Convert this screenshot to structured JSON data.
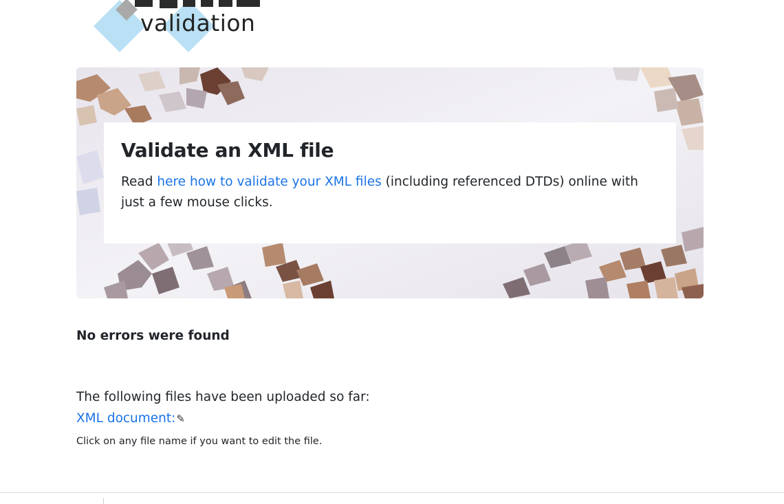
{
  "logo": {
    "text": "validation",
    "colors": {
      "diamond": "#b9e0f4",
      "dark": "#2b2b2b",
      "gray": "#a9a9a9"
    }
  },
  "hero": {
    "title": "Validate an XML file",
    "text_before": "Read ",
    "link_text": "here how to validate your XML files",
    "text_after": " (including referenced DTDs) online with just a few mouse clicks."
  },
  "result": {
    "message": "No errors were found"
  },
  "files": {
    "intro": "The following files have been uploaded so far:",
    "items": [
      {
        "label": "XML document:",
        "icon": "pencil-icon"
      }
    ],
    "hint": "Click on any file name if you want to edit the file."
  },
  "colors": {
    "link": "#1a73e8",
    "text": "#212529"
  }
}
